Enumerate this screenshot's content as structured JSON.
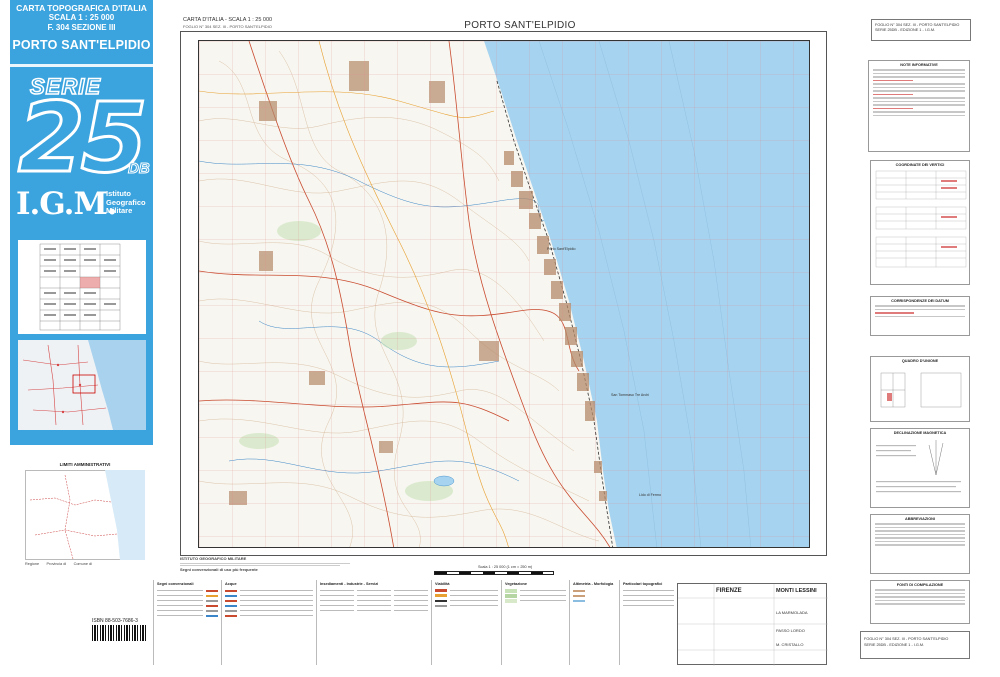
{
  "cover": {
    "header_line1": "CARTA TOPOGRAFICA D'ITALIA",
    "header_line2": "SCALA  1 : 25 000",
    "header_line3": "F. 304 SEZIONE III",
    "title": "PORTO SANT'ELPIDIO",
    "serie_label": "SERIE",
    "serie_number": "25",
    "serie_suffix": "DB",
    "igm_logo": "I.G.M.",
    "igm_sub1": "Istituto",
    "igm_sub2": "Geografico",
    "igm_sub3": "Militare",
    "color_brand": "#3ba3dd"
  },
  "admin_limits": {
    "title": "LIMITI AMMINISTRATIVI",
    "legend": [
      "Regione",
      "Provincia di",
      "Comune di"
    ]
  },
  "isbn": "ISBN 88-503-7686-3",
  "map_header": {
    "left_line1": "CARTA D'ITALIA  -  SCALA 1 : 25 000",
    "left_line2": "FOGLIO N° 304 SEZ. III  -  PORTO SANT'ELPIDIO",
    "title": "PORTO SANT'ELPIDIO"
  },
  "map": {
    "sea_color": "#a6d3ef",
    "land_color": "#f7f6f0",
    "places": [
      "Porto Sant'Elpidio",
      "San Tommaso Tre Archi",
      "Lido di Fermo"
    ]
  },
  "map_notes": {
    "title": "ISTITUTO GEOGRAFICO MILITARE",
    "legend_title": "Segni convenzionali di uso più frequente"
  },
  "scale_label": "Scala 1 : 25 000  (1 cm = 250 m)",
  "bottom_legend": {
    "columns": [
      "Segni convenzionali",
      "Acque",
      "Insediamenti - Industrie - Servizi",
      "Viabilità",
      "Vegetazione",
      "Altimetria - Morfologia",
      "Particolari topografici"
    ],
    "quadro": {
      "city1": "FIRENZE",
      "city2": "MONTI LESSINI",
      "place1": "LA MARMOLADA",
      "place2": "PASSO LORDO",
      "place3": "M. CRISTALLO"
    }
  },
  "right_column": {
    "top_box_line1": "FOGLIO N° 304 SEZ. III  -  PORTO SANT'ELPIDIO",
    "top_box_line2": "SERIE 25DB  -  EDIZIONE 1  -  I.G.M.",
    "sections": [
      "NOTE INFORMATIVE",
      "COORDINATE DEI VERTICI",
      "CORRISPONDENZE DEI DATUM",
      "QUADRO D'UNIONE",
      "DECLINAZIONE MAGNETICA",
      "ABBREVIAZIONI",
      "FONTI DI COMPILAZIONE"
    ],
    "bottom_box_line1": "FOGLIO N° 304 SEZ. III  -  PORTO SANT'ELPIDIO",
    "bottom_box_line2": "SERIE 25DB  -  EDIZIONE 1  -  I.G.M."
  }
}
